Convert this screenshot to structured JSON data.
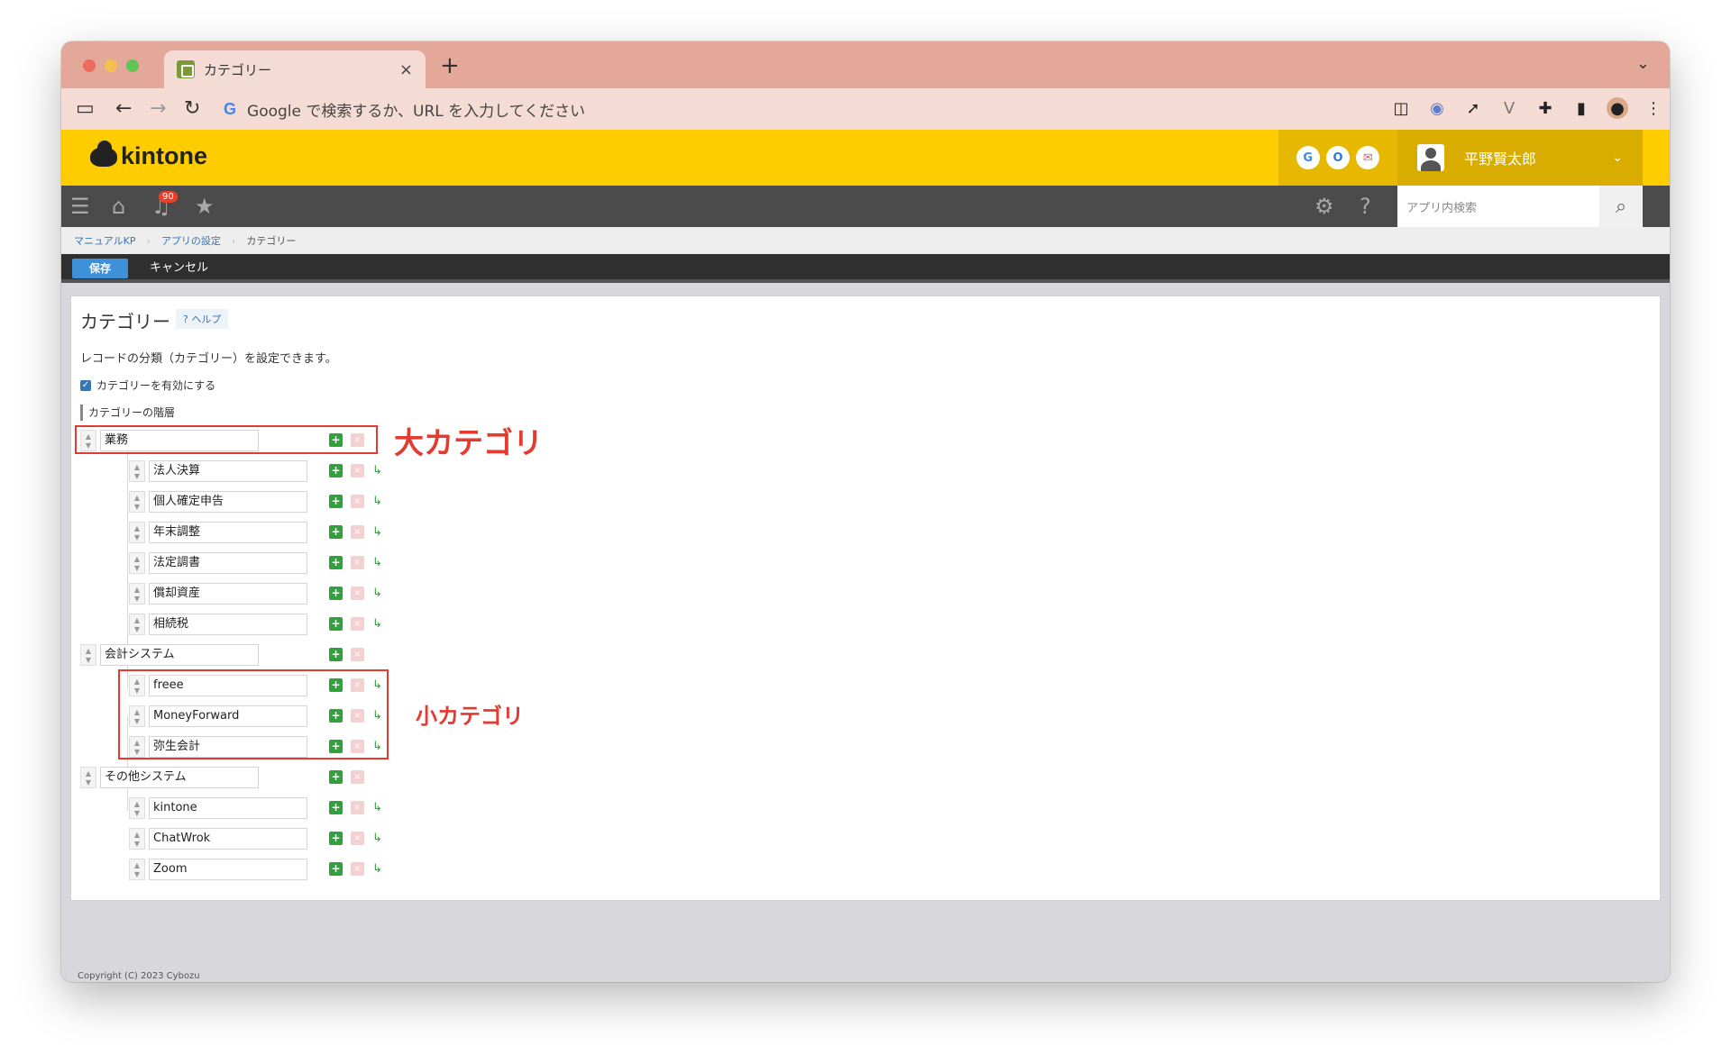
{
  "browser": {
    "tab_title": "カテゴリー",
    "tab_close": "×",
    "new_tab": "+",
    "tab_menu": "⌄",
    "omnibox_g": "G",
    "omnibox_text": "Google で検索するか、URL を入力してください"
  },
  "header": {
    "logo": "kintone",
    "apps": [
      "G",
      "O",
      "✉"
    ],
    "user_name": "平野賢太郎",
    "user_chevron": "⌄"
  },
  "nav": {
    "notification_count": "90",
    "search_placeholder": "アプリ内検索",
    "icons": [
      "menu-icon",
      "home-icon",
      "bell-icon",
      "star-icon",
      "gear-icon",
      "help-icon",
      "search-icon"
    ]
  },
  "breadcrumb": {
    "items": [
      "マニュアルKP",
      "アプリの設定"
    ],
    "current": "カテゴリー"
  },
  "actions": {
    "save": "保存",
    "cancel": "キャンセル"
  },
  "main": {
    "title": "カテゴリー",
    "help": "? ヘルプ",
    "description": "レコードの分類（カテゴリー）を設定できます。",
    "enable_checkbox_label": "カテゴリーを有効にする",
    "enable_checked": true,
    "hierarchy_label": "カテゴリーの階層",
    "categories": [
      {
        "name": "業務",
        "children": [
          "法人決算",
          "個人確定申告",
          "年末調整",
          "法定調書",
          "償却資産",
          "相続税"
        ]
      },
      {
        "name": "会計システム",
        "children": [
          "freee",
          "MoneyForward",
          "弥生会計"
        ]
      },
      {
        "name": "その他システム",
        "children": [
          "kintone",
          "ChatWrok",
          "Zoom"
        ]
      }
    ]
  },
  "annotations": {
    "large_category": "大カテゴリ",
    "small_category": "小カテゴリ"
  },
  "footer": {
    "copyright": "Copyright (C) 2023 Cybozu"
  },
  "colors": {
    "kintone_yellow": "#ffcc00",
    "nav_dark": "#4b4b4b",
    "save_blue": "#3e90d8",
    "annotation_red": "#e53a30",
    "add_green": "#2fa23b"
  }
}
